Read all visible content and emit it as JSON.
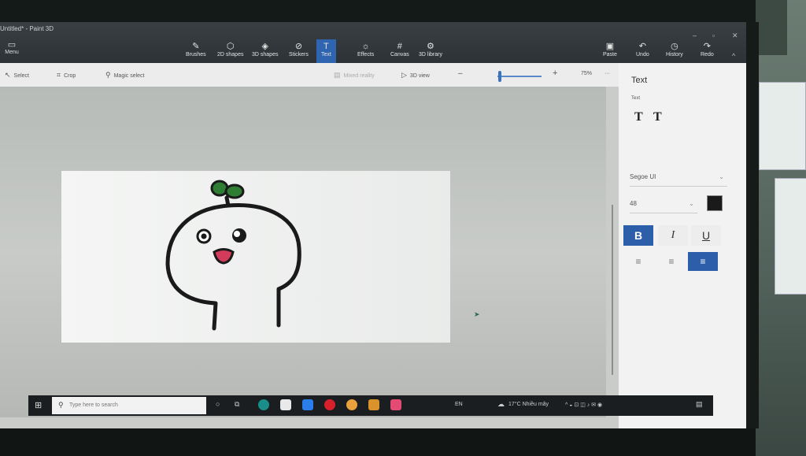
{
  "window": {
    "title": "Untitled* - Paint 3D"
  },
  "menu": {
    "label": "Menu"
  },
  "ribbon": {
    "tools": [
      {
        "label": "Brushes",
        "icon": "brush-icon"
      },
      {
        "label": "2D shapes",
        "icon": "2d-shapes-icon"
      },
      {
        "label": "3D shapes",
        "icon": "3d-shapes-icon"
      },
      {
        "label": "Stickers",
        "icon": "stickers-icon"
      },
      {
        "label": "Text",
        "icon": "text-icon",
        "active": true
      },
      {
        "label": "Effects",
        "icon": "effects-icon"
      },
      {
        "label": "Canvas",
        "icon": "canvas-icon"
      },
      {
        "label": "3D library",
        "icon": "3d-library-icon"
      }
    ],
    "right": [
      {
        "label": "Paste",
        "icon": "paste-icon"
      },
      {
        "label": "Undo",
        "icon": "undo-icon"
      },
      {
        "label": "History",
        "icon": "history-icon"
      },
      {
        "label": "Redo",
        "icon": "redo-icon"
      }
    ]
  },
  "toolbar": {
    "select": "Select",
    "crop": "Crop",
    "magic_select": "Magic select",
    "mixed_reality": "Mixed reality",
    "view_3d": "3D view",
    "zoom": "75%",
    "zoom_value": 75,
    "more": "···"
  },
  "panel": {
    "title": "Text",
    "subtitle": "Text",
    "font": "Segoe UI",
    "size": "48",
    "color": "#1a1a1a",
    "bold": "B",
    "italic": "I",
    "underline": "U"
  },
  "taskbar": {
    "search_placeholder": "Type here to search",
    "lang": "EN",
    "weather": "17°C  Nhiều mây"
  },
  "colors": {
    "accent": "#2c5ea9",
    "doodle_stroke": "#1a1a1a",
    "leaf": "#2e7d32",
    "mouth": "#d23c5a"
  }
}
